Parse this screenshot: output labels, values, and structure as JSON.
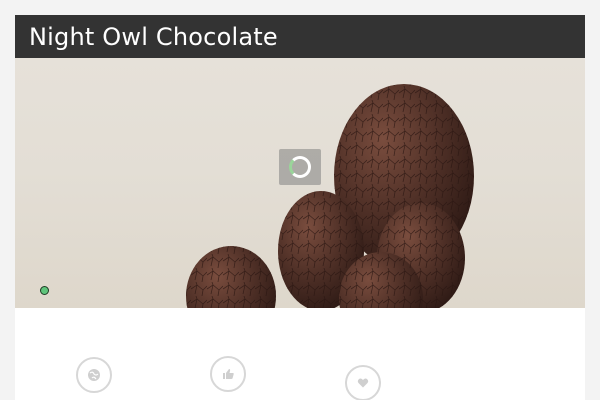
{
  "header": {
    "title": "Night Owl Chocolate"
  },
  "slider": {
    "loader_icon": "spinner-icon",
    "active_dot_color": "#5fc47b"
  },
  "features": [
    {
      "icon": "globe-icon"
    },
    {
      "icon": "thumbs-up-icon"
    },
    {
      "icon": "heart-icon"
    }
  ],
  "colors": {
    "header_bg": "#333333",
    "header_text": "#ffffff",
    "egg": "#4e2f26"
  }
}
